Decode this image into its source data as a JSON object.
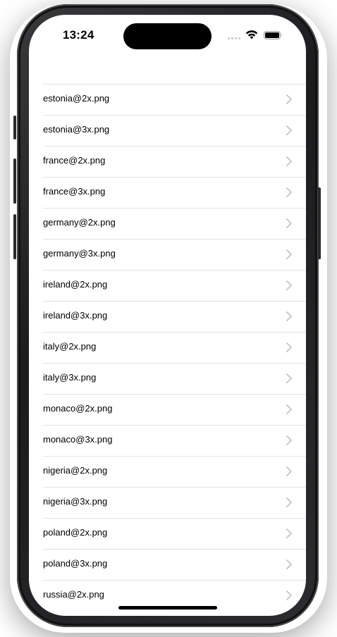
{
  "status_bar": {
    "time": "13:24",
    "icons": [
      "cellular-signal-icon",
      "wifi-icon",
      "battery-icon"
    ]
  },
  "file_list": {
    "items": [
      "estonia@2x.png",
      "estonia@3x.png",
      "france@2x.png",
      "france@3x.png",
      "germany@2x.png",
      "germany@3x.png",
      "ireland@2x.png",
      "ireland@3x.png",
      "italy@2x.png",
      "italy@3x.png",
      "monaco@2x.png",
      "monaco@3x.png",
      "nigeria@2x.png",
      "nigeria@3x.png",
      "poland@2x.png",
      "poland@3x.png",
      "russia@2x.png"
    ],
    "accessory_icon": "chevron-right-icon"
  },
  "colors": {
    "separator": "#e3e3e6",
    "chevron": "#c4c4c7",
    "background": "#ffffff"
  }
}
